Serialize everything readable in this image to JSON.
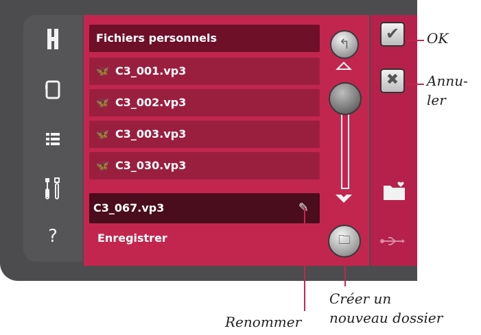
{
  "sidebar": {
    "icons": [
      "home-icon",
      "tablet-icon",
      "list-icon",
      "tools-icon",
      "help-icon"
    ],
    "help_label": "?"
  },
  "panel": {
    "title": "Fichiers personnels",
    "files": [
      {
        "name": "C3_001.vp3",
        "icon": "butterfly-icon"
      },
      {
        "name": "C3_002.vp3",
        "icon": "butterfly-icon"
      },
      {
        "name": "C3_003.vp3",
        "icon": "butterfly-icon"
      },
      {
        "name": "C3_030.vp3",
        "icon": "butterfly-icon"
      }
    ],
    "filename_value": "C3_067.vp3",
    "save_label": "Enregistrer"
  },
  "actions": {
    "ok_symbol": "✔",
    "cancel_symbol": "✖"
  },
  "callouts": {
    "ok": "OK",
    "cancel_line1": "Annu-",
    "cancel_line2": "ler",
    "rename": "Renommer",
    "new_folder_line1": "Créer un",
    "new_folder_line2": "nouveau dossier"
  },
  "colors": {
    "panel": "#c2264e",
    "row": "#9a1f3f",
    "frame": "#4c4c4e"
  }
}
